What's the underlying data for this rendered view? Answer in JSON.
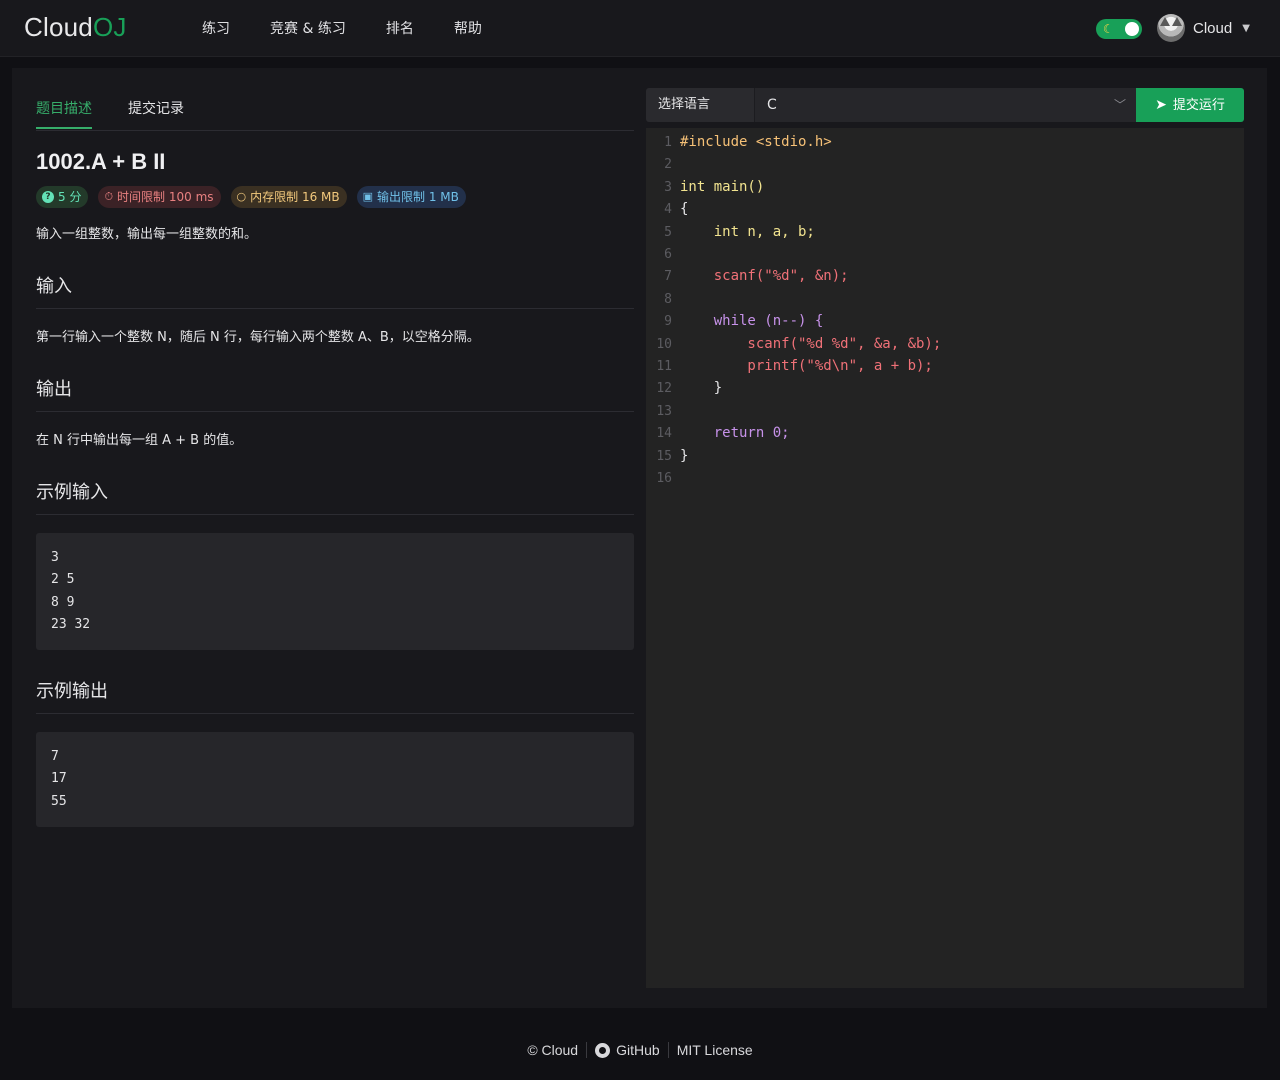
{
  "header": {
    "logo_part1": "Cloud",
    "logo_part2": "OJ",
    "nav": [
      "练习",
      "竞赛 & 练习",
      "排名",
      "帮助"
    ],
    "theme_icon": "moon-icon",
    "user_name": "Cloud"
  },
  "problem": {
    "tabs": {
      "description": "题目描述",
      "submissions": "提交记录"
    },
    "title": "1002.A + B II",
    "tags": {
      "score": "5 分",
      "time": "时间限制 100 ms",
      "memory": "内存限制 16 MB",
      "output": "输出限制 1 MB"
    },
    "description": "输入一组整数，输出每一组整数的和。",
    "input_heading": "输入",
    "input_text": "第一行输入一个整数 N，随后 N 行，每行输入两个整数 A、B，以空格分隔。",
    "output_heading": "输出",
    "output_text": "在 N 行中输出每一组 A + B 的值。",
    "sample_input_heading": "示例输入",
    "sample_input": "3\n2 5\n8 9\n23 32",
    "sample_output_heading": "示例输出",
    "sample_output": "7\n17\n55"
  },
  "editor": {
    "lang_label": "选择语言",
    "lang_value": "C",
    "submit_label": "提交运行",
    "line_numbers": [
      "1",
      "2",
      "3",
      "4",
      "5",
      "6",
      "7",
      "8",
      "9",
      "10",
      "11",
      "12",
      "13",
      "14",
      "15",
      "16"
    ],
    "code": [
      "#include <stdio.h>",
      "",
      "int main()",
      "{",
      "    int n, a, b;",
      "",
      "    scanf(\"%d\", &n);",
      "",
      "    while (n--) {",
      "        scanf(\"%d %d\", &a, &b);",
      "        printf(\"%d\\n\", a + b);",
      "    }",
      "",
      "    return 0;",
      "}",
      ""
    ]
  },
  "footer": {
    "copyright": "© Cloud",
    "github": "GitHub",
    "license": "MIT License"
  },
  "colors": {
    "accent": "#18a058",
    "background": "#101014",
    "card": "#18181c",
    "editor": "#232323"
  }
}
